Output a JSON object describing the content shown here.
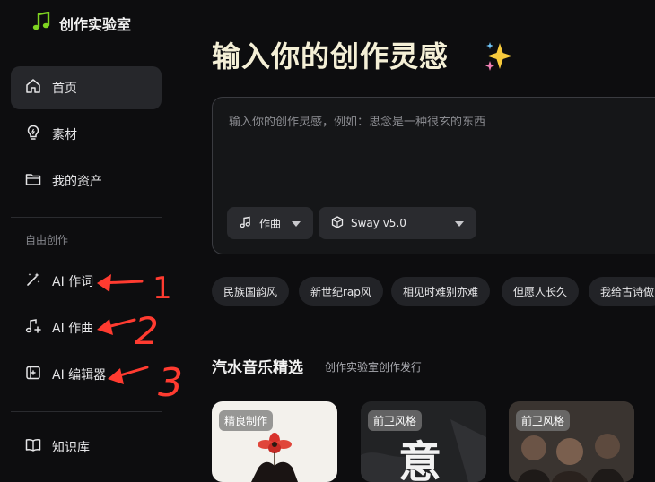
{
  "app": {
    "name": "创作实验室"
  },
  "sidebar": {
    "items": [
      {
        "label": "首页",
        "icon": "home-icon",
        "active": true
      },
      {
        "label": "素材",
        "icon": "lightbulb-icon",
        "active": false
      },
      {
        "label": "我的资产",
        "icon": "folder-icon",
        "active": false
      }
    ],
    "section_label": "自由创作",
    "create_items": [
      {
        "label": "AI 作词",
        "icon": "magic-wand-icon"
      },
      {
        "label": "AI 作曲",
        "icon": "music-note-plus-icon"
      },
      {
        "label": "AI 编辑器",
        "icon": "editor-panel-icon"
      }
    ],
    "bottom_items": [
      {
        "label": "知识库",
        "icon": "book-icon"
      }
    ]
  },
  "main": {
    "hero_title": "输入你的创作灵感",
    "hero_emoji_icon": "sparkles-icon",
    "prompt": {
      "placeholder": "输入你的创作灵感，例如：思念是一种很玄的东西",
      "value": ""
    },
    "mode_select": {
      "value": "作曲",
      "icon": "music-note-icon"
    },
    "model_select": {
      "value": "Sway v5.0",
      "icon": "cube-icon"
    },
    "chips": [
      "民族国韵风",
      "新世纪rap风",
      "相见时难别亦难",
      "但愿人长久",
      "我给古诗做"
    ],
    "section": {
      "title": "汽水音乐精选",
      "subtitle": "创作实验室创作发行"
    },
    "cards": [
      {
        "badge": "精良制作"
      },
      {
        "badge": "前卫风格",
        "cover_text": "意"
      },
      {
        "badge": "前卫风格"
      }
    ]
  },
  "annotations": {
    "color": "#ff3b30",
    "numbers": [
      "1",
      "2",
      "3"
    ]
  },
  "colors": {
    "background": "#0d0d0f",
    "active_nav": "#26272b",
    "logo_green": "#7ed321",
    "hero_title": "#f4efd6"
  }
}
